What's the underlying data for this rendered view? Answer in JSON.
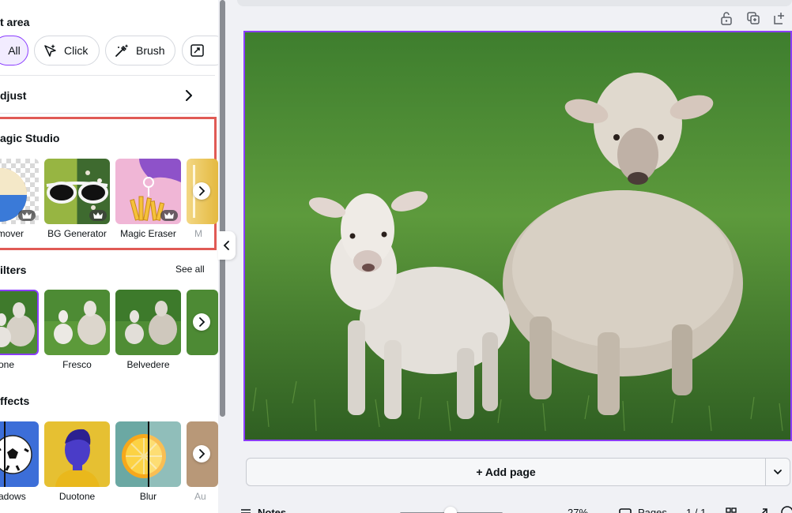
{
  "panel": {
    "select_area": {
      "title": "t area",
      "options": [
        {
          "label": "All",
          "icon": "all-icon"
        },
        {
          "label": "Click",
          "icon": "sparkle-cursor-icon"
        },
        {
          "label": "Brush",
          "icon": "magic-brush-icon"
        },
        {
          "label": "",
          "icon": "expand-image-icon"
        }
      ]
    },
    "adjust": {
      "label": "djust",
      "icon": "chevron-right-icon"
    },
    "magic_studio": {
      "title": "agic Studio",
      "tools": [
        {
          "label": "emover",
          "pro": true
        },
        {
          "label": "BG Generator",
          "pro": true
        },
        {
          "label": "Magic Eraser",
          "pro": true
        },
        {
          "label": "M",
          "pro": false
        }
      ],
      "highlight_color": "#e05a55"
    },
    "filters": {
      "title": "ilters",
      "see_all": "See all",
      "items": [
        {
          "label": "one",
          "selected": true
        },
        {
          "label": "Fresco",
          "selected": false
        },
        {
          "label": "Belvedere",
          "selected": false
        }
      ]
    },
    "effects": {
      "title": "ffects",
      "items": [
        {
          "label": "adows"
        },
        {
          "label": "Duotone"
        },
        {
          "label": "Blur"
        },
        {
          "label": "Au"
        }
      ]
    }
  },
  "canvas": {
    "toolbar_icons": [
      "lock-icon",
      "duplicate-icon",
      "add-page-icon"
    ],
    "selection_color": "#8b3dff",
    "add_page_label": "+ Add page"
  },
  "footer": {
    "notes_label": "Notes",
    "zoom": "27%",
    "pages_label": "Pages",
    "page_count": "1 / 1"
  }
}
